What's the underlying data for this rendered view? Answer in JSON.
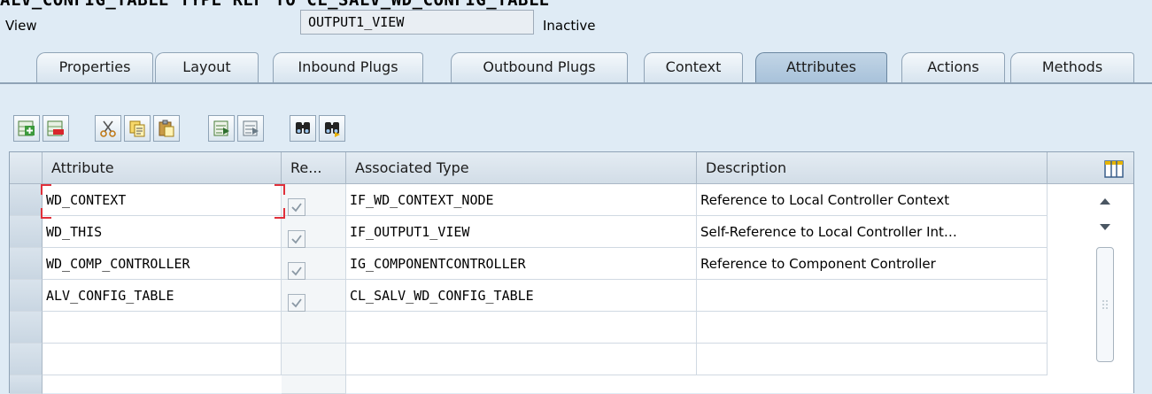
{
  "heading": "ALV_CONFIG_TABLE TYPE REF TO CL_SALV_WD_CONFIG_TABLE",
  "view": {
    "label": "View",
    "value": "OUTPUT1_VIEW",
    "status": "Inactive"
  },
  "tabs": [
    {
      "label": "Properties",
      "active": false
    },
    {
      "label": "Layout",
      "active": false
    },
    {
      "label": "Inbound Plugs",
      "active": false
    },
    {
      "label": "Outbound Plugs",
      "active": false
    },
    {
      "label": "Context",
      "active": false
    },
    {
      "label": "Attributes",
      "active": true
    },
    {
      "label": "Actions",
      "active": false
    },
    {
      "label": "Methods",
      "active": false
    }
  ],
  "toolbar": {
    "buttons": [
      "insert-row-icon",
      "delete-row-icon",
      "cut-icon",
      "copy-icon",
      "paste-icon",
      "select-block-icon",
      "deselect-icon",
      "find-icon",
      "find-next-icon"
    ]
  },
  "table": {
    "columns": [
      "Attribute",
      "Re...",
      "Associated Type",
      "Description"
    ],
    "rows": [
      {
        "attribute": "WD_CONTEXT",
        "ref": true,
        "type": "IF_WD_CONTEXT_NODE",
        "description": "Reference to Local Controller Context"
      },
      {
        "attribute": "WD_THIS",
        "ref": true,
        "type": "IF_OUTPUT1_VIEW",
        "description": "Self-Reference to Local Controller Int…"
      },
      {
        "attribute": "WD_COMP_CONTROLLER",
        "ref": true,
        "type": "IG_COMPONENTCONTROLLER",
        "description": "Reference to Component Controller"
      },
      {
        "attribute": "ALV_CONFIG_TABLE",
        "ref": true,
        "type": "CL_SALV_WD_CONFIG_TABLE",
        "description": ""
      }
    ]
  },
  "colors": {
    "background": "#dfebf5",
    "selection": "#e0303a",
    "tab_active": "#a8c2da"
  }
}
